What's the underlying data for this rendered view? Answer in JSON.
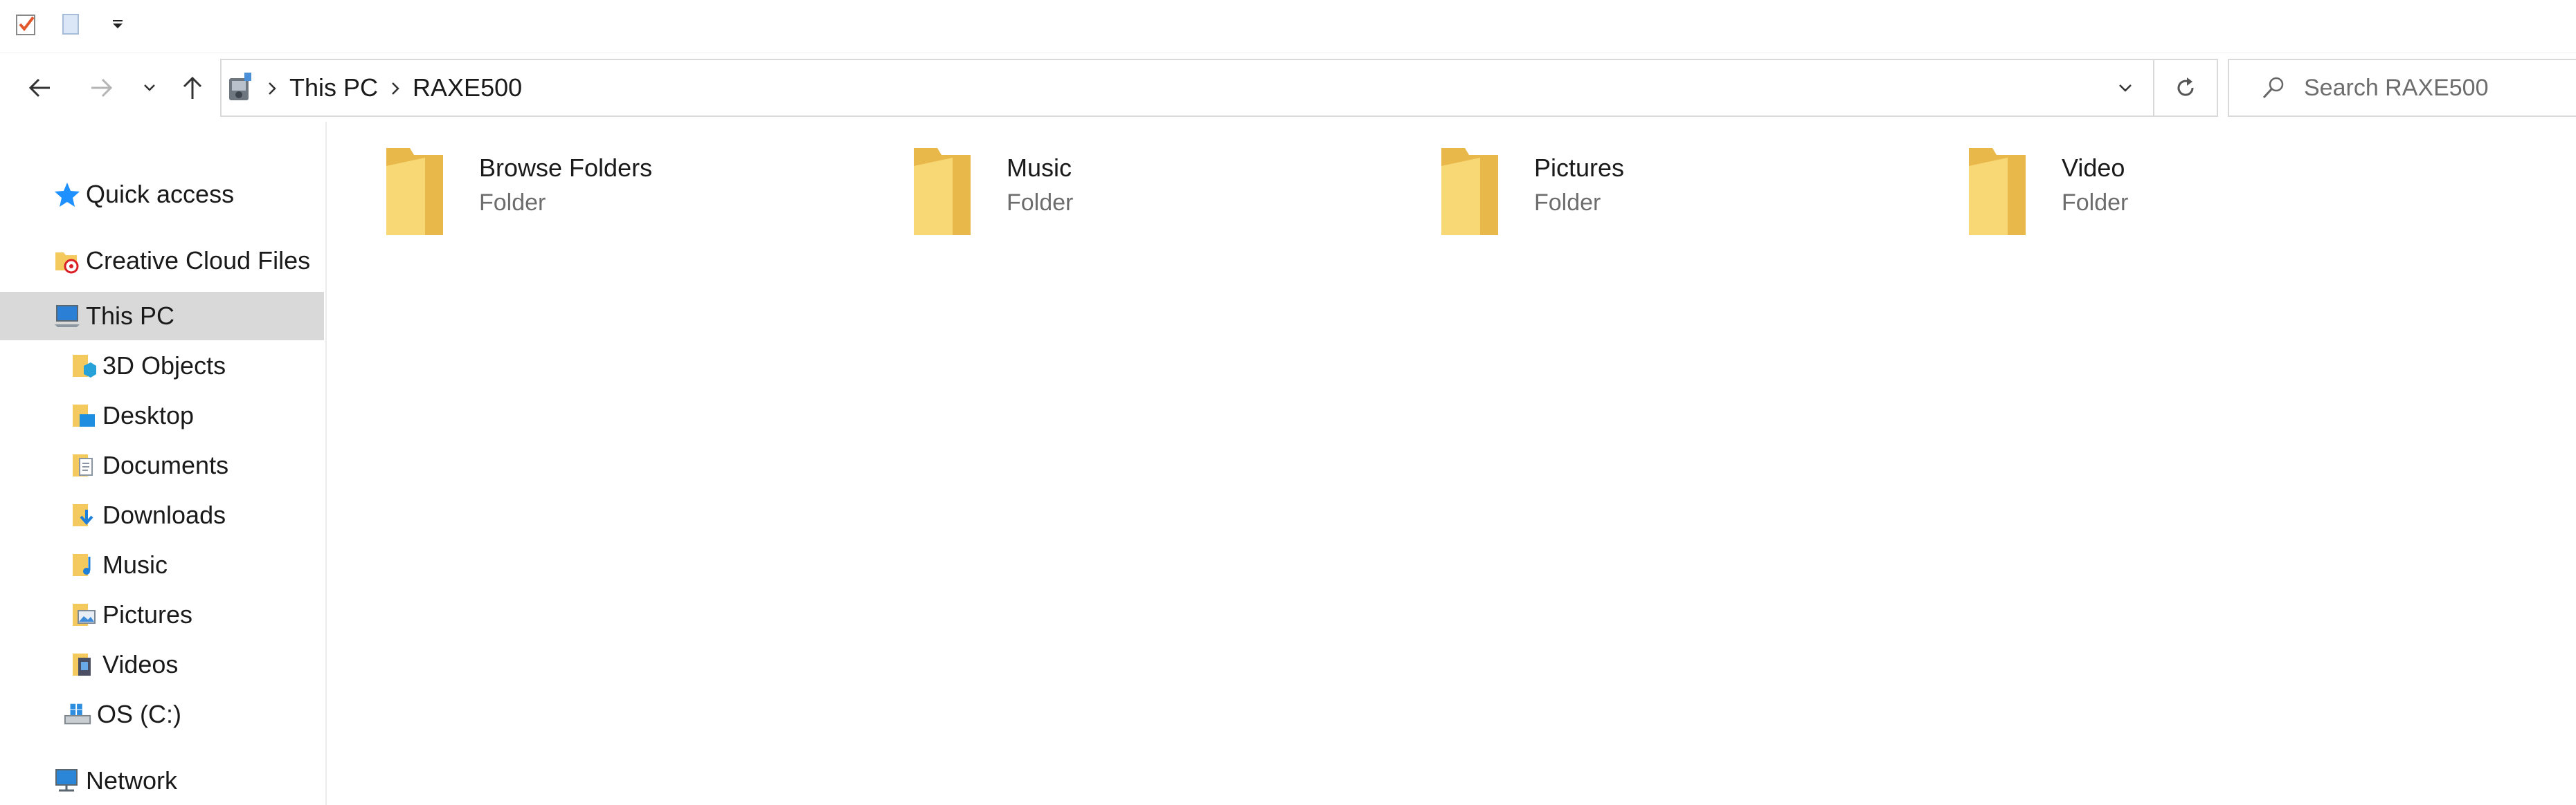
{
  "quick_access_toolbar": {
    "items": [
      {
        "name": "properties-icon"
      },
      {
        "name": "new-folder-icon"
      },
      {
        "name": "customize-toolbar-icon"
      }
    ]
  },
  "address_bar": {
    "breadcrumbs": [
      "This PC",
      "RAXE500"
    ],
    "device_icon": "camera-device-icon"
  },
  "search": {
    "placeholder": "Search RAXE500"
  },
  "nav_pane": {
    "items": [
      {
        "label": "Quick access",
        "icon": "star-icon"
      },
      {
        "label": "Creative Cloud Files",
        "icon": "creative-cloud-folder-icon"
      },
      {
        "label": "This PC",
        "icon": "computer-icon",
        "selected": true
      },
      {
        "label": "3D Objects",
        "icon": "3d-objects-icon"
      },
      {
        "label": "Desktop",
        "icon": "desktop-icon"
      },
      {
        "label": "Documents",
        "icon": "documents-icon"
      },
      {
        "label": "Downloads",
        "icon": "downloads-icon"
      },
      {
        "label": "Music",
        "icon": "music-icon"
      },
      {
        "label": "Pictures",
        "icon": "pictures-icon"
      },
      {
        "label": "Videos",
        "icon": "videos-icon"
      },
      {
        "label": "OS (C:)",
        "icon": "drive-icon"
      },
      {
        "label": "Network",
        "icon": "network-icon"
      }
    ]
  },
  "content": {
    "items": [
      {
        "name": "Browse Folders",
        "type": "Folder"
      },
      {
        "name": "Music",
        "type": "Folder"
      },
      {
        "name": "Pictures",
        "type": "Folder"
      },
      {
        "name": "Video",
        "type": "Folder"
      }
    ]
  },
  "colors": {
    "selection": "#d9d9d9",
    "folder_yellow": "#f8d775",
    "folder_dark": "#e8b84a",
    "accent_blue": "#1e90ff"
  }
}
